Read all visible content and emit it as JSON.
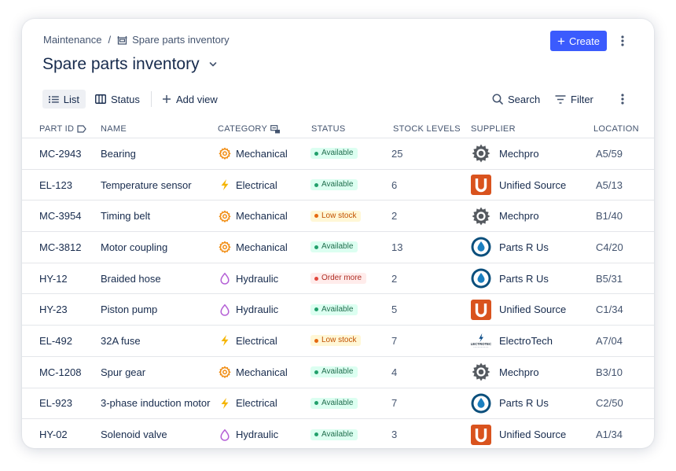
{
  "breadcrumb": {
    "root": "Maintenance",
    "separator": "/",
    "current": "Spare parts inventory"
  },
  "page": {
    "title": "Spare parts inventory"
  },
  "actions": {
    "create_label": "Create"
  },
  "toolbar": {
    "views": [
      {
        "label": "List",
        "icon": "list-icon",
        "active": true
      },
      {
        "label": "Status",
        "icon": "columns-icon",
        "active": false
      }
    ],
    "add_view_label": "Add view",
    "search_label": "Search",
    "filter_label": "Filter"
  },
  "table": {
    "columns": [
      "PART ID",
      "NAME",
      "CATEGORY",
      "STATUS",
      "STOCK LEVELS",
      "SUPPLIER",
      "LOCATION"
    ],
    "rows": [
      {
        "part_id": "MC-2943",
        "name": "Bearing",
        "category": "Mechanical",
        "status": "Available",
        "stock": "25",
        "supplier": "Mechpro",
        "location": "A5/59"
      },
      {
        "part_id": "EL-123",
        "name": "Temperature sensor",
        "category": "Electrical",
        "status": "Available",
        "stock": "6",
        "supplier": "Unified Source",
        "location": "A5/13"
      },
      {
        "part_id": "MC-3954",
        "name": "Timing belt",
        "category": "Mechanical",
        "status": "Low stock",
        "stock": "2",
        "supplier": "Mechpro",
        "location": "B1/40"
      },
      {
        "part_id": "MC-3812",
        "name": "Motor coupling",
        "category": "Mechanical",
        "status": "Available",
        "stock": "13",
        "supplier": "Parts R Us",
        "location": "C4/20"
      },
      {
        "part_id": "HY-12",
        "name": "Braided hose",
        "category": "Hydraulic",
        "status": "Order more",
        "stock": "2",
        "supplier": "Parts R Us",
        "location": "B5/31"
      },
      {
        "part_id": "HY-23",
        "name": "Piston pump",
        "category": "Hydraulic",
        "status": "Available",
        "stock": "5",
        "supplier": "Unified Source",
        "location": "C1/34"
      },
      {
        "part_id": "EL-492",
        "name": "32A fuse",
        "category": "Electrical",
        "status": "Low stock",
        "stock": "7",
        "supplier": "ElectroTech",
        "location": "A7/04"
      },
      {
        "part_id": "MC-1208",
        "name": "Spur gear",
        "category": "Mechanical",
        "status": "Available",
        "stock": "4",
        "supplier": "Mechpro",
        "location": "B3/10"
      },
      {
        "part_id": "EL-923",
        "name": "3-phase induction motor",
        "category": "Electrical",
        "status": "Available",
        "stock": "7",
        "supplier": "Parts R Us",
        "location": "C2/50"
      },
      {
        "part_id": "HY-02",
        "name": "Solenoid valve",
        "category": "Hydraulic",
        "status": "Available",
        "stock": "3",
        "supplier": "Unified Source",
        "location": "A1/34"
      }
    ]
  },
  "supplier_logos": {
    "Mechpro": "gear-logo",
    "Unified Source": "u-logo",
    "Parts R Us": "drop-logo",
    "ElectroTech": "electrotech-logo"
  },
  "colors": {
    "accent": "#3b5bfd",
    "available": "#22a06b",
    "low_stock": "#e56910",
    "order_more": "#e2483d",
    "mechanical": "#f18d13",
    "electrical": "#f5b400",
    "hydraulic": "#b45fd6"
  }
}
